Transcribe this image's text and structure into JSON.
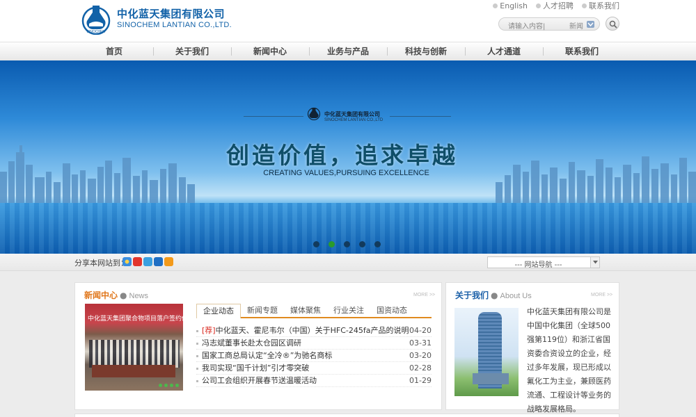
{
  "brand": {
    "name_cn": "中化蓝天集团有限公司",
    "name_en": "SINOCHEM LANTIAN CO.,LTD.",
    "accent": "#1262a8"
  },
  "toplinks": [
    {
      "label": "English",
      "icon": "globe-dot-icon"
    },
    {
      "label": "人才招聘",
      "icon": "person-dot-icon"
    },
    {
      "label": "联系我们",
      "icon": "contact-dot-icon"
    }
  ],
  "search": {
    "placeholder": "请输入内容|",
    "scope": "新闻"
  },
  "nav": [
    "首页",
    "关于我们",
    "新闻中心",
    "业务与产品",
    "科技与创新",
    "人才通道",
    "联系我们"
  ],
  "banner": {
    "company_cn": "中化蓝天集团有限公司",
    "company_en": "SINOCHEM LANTIAN CO.,LTD",
    "slogan": "创造价值，追求卓越",
    "slogan_en": "CREATING VALUES,PURSUING EXCELLENCE",
    "slide_count": 5,
    "active_slide": 2
  },
  "share": {
    "label": "分享本网站到：",
    "icons": [
      "qzone-icon",
      "weibo-icon",
      "tencent-weibo-icon",
      "renren-icon",
      "kaixin-icon"
    ]
  },
  "site_nav": {
    "label": "---  网站导航  ---"
  },
  "news": {
    "title_cn": "新闻中心",
    "title_en": "News",
    "more": "MORE >>",
    "photo_caption": "中化蓝天集团聚合物项目落户签约仪",
    "tabs": [
      "企业动态",
      "新闻专题",
      "媒体聚焦",
      "行业关注",
      "国资动态"
    ],
    "active_tab": 0,
    "items": [
      {
        "tag": "[荐]",
        "title": "中化蓝天、霍尼韦尔（中国）关于HFC-245fa产品的说明",
        "date": "04-20"
      },
      {
        "tag": "",
        "title": "冯志斌董事长赴太仓园区调研",
        "date": "03-31"
      },
      {
        "tag": "",
        "title": "国家工商总局认定“全冷®”为驰名商标",
        "date": "03-20"
      },
      {
        "tag": "",
        "title": "我司实现“国千计划”引才零突破",
        "date": "02-28"
      },
      {
        "tag": "",
        "title": "公司工会组织开展春节送温暖活动",
        "date": "01-29"
      }
    ]
  },
  "about": {
    "title_cn": "关于我们",
    "title_en": "About Us",
    "more": "MORE >>",
    "text": "中化蓝天集团有限公司是中国中化集团（全球500强第119位）和浙江省国资委合资设立的企业，经过多年发展，现已形成以氟化工为主业，兼顾医药流通、工程设计等业务的战略发展格局。"
  }
}
